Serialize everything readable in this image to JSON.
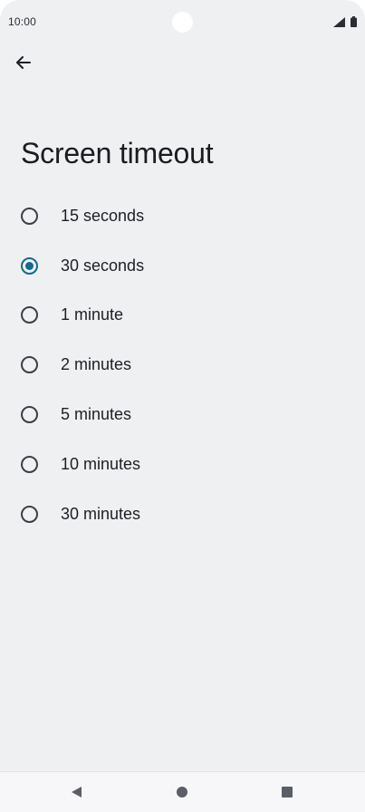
{
  "status_bar": {
    "time": "10:00",
    "icons": [
      "signal-icon",
      "battery-icon"
    ]
  },
  "header": {
    "back_icon": "arrow-left-icon",
    "title": "Screen timeout"
  },
  "options": [
    {
      "label": "15 seconds",
      "selected": false
    },
    {
      "label": "30 seconds",
      "selected": true
    },
    {
      "label": "1 minute",
      "selected": false
    },
    {
      "label": "2 minutes",
      "selected": false
    },
    {
      "label": "5 minutes",
      "selected": false
    },
    {
      "label": "10 minutes",
      "selected": false
    },
    {
      "label": "30 minutes",
      "selected": false
    }
  ],
  "nav_bar": {
    "icons": [
      "back-triangle-icon",
      "home-circle-icon",
      "recents-square-icon"
    ]
  },
  "colors": {
    "background": "#eff0f2",
    "accent": "#146a8c",
    "text": "#1e1f24"
  }
}
